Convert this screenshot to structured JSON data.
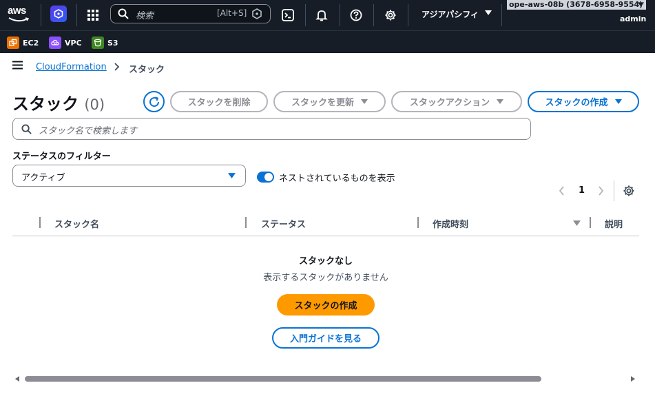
{
  "topnav": {
    "logo_text": "aws",
    "search_placeholder": "検索",
    "search_shortcut": "[Alt+S]",
    "region": "アジアパシフィ",
    "account": "ope-aws-08b (3678-6958-9554)",
    "user": "admin"
  },
  "favorites": [
    {
      "label": "EC2",
      "color": "#ed7100"
    },
    {
      "label": "VPC",
      "color": "#8c4fff"
    },
    {
      "label": "S3",
      "color": "#3f8624"
    }
  ],
  "breadcrumb": {
    "root": "CloudFormation",
    "current": "スタック"
  },
  "header": {
    "title": "スタック",
    "count": "(0)",
    "delete_label": "スタックを削除",
    "update_label": "スタックを更新",
    "actions_label": "スタックアクション",
    "create_label": "スタックの作成"
  },
  "search": {
    "placeholder": "スタック名で検索します"
  },
  "filter": {
    "label": "ステータスのフィルター",
    "selected": "アクティブ",
    "toggle_label": "ネストされているものを表示",
    "toggle_on": true
  },
  "pagination": {
    "current_page": "1"
  },
  "table": {
    "columns": [
      "スタック名",
      "ステータス",
      "作成時刻",
      "説明"
    ]
  },
  "empty_state": {
    "title": "スタックなし",
    "subtitle": "表示するスタックがありません",
    "create_label": "スタックの作成",
    "guide_label": "入門ガイドを見る"
  },
  "colors": {
    "accent": "#0972d3",
    "primary_button": "#ff9900",
    "nav_bg": "#161d26"
  }
}
